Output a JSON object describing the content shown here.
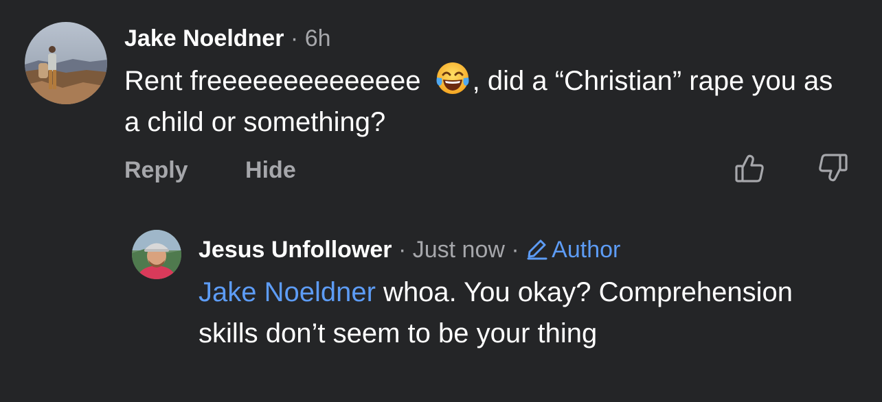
{
  "comment": {
    "author": "Jake Noeldner",
    "separator": "·",
    "time": "6h",
    "text_before_emoji": "Rent freeeeeeeeeeeeee ",
    "emoji": "face-with-tears-of-joy",
    "text_after_emoji": ", did a “Christian” rape you as a child or something?",
    "actions": {
      "reply": "Reply",
      "hide": "Hide"
    },
    "icons": {
      "upvote": "thumbs-up-icon",
      "downvote": "thumbs-down-icon"
    }
  },
  "reply": {
    "author": "Jesus Unfollower",
    "separator": "·",
    "time": "Just now",
    "separator2": "·",
    "badge_icon": "pencil-icon",
    "badge": "Author",
    "mention": "Jake Noeldner",
    "text": " whoa. You okay? Comprehension skills don’t seem to be your thing"
  },
  "colors": {
    "background": "#242527",
    "text": "#ffffff",
    "muted": "#a6a7ab",
    "link": "#5d9cf5"
  }
}
